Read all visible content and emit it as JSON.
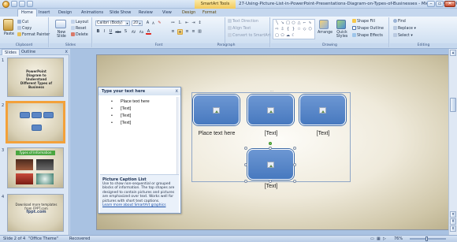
{
  "window": {
    "title": "27-Using-Picture-List-in-PowerPoint-Presentations-Diagram-on-Types-of-Businesses - Microsoft PowerPoint",
    "contextual_header": "SmartArt Tools",
    "minimize": "–",
    "maximize": "▫",
    "close": "✕"
  },
  "tabs": [
    "Home",
    "Insert",
    "Design",
    "Animations",
    "Slide Show",
    "Review",
    "View",
    "Design",
    "Format"
  ],
  "ribbon": {
    "clipboard": {
      "label": "Clipboard",
      "paste": "Paste",
      "cut": "Cut",
      "copy": "Copy",
      "format_painter": "Format Painter"
    },
    "slides": {
      "label": "Slides",
      "new_slide": "New Slide",
      "layout": "Layout",
      "reset": "Reset",
      "delete": "Delete"
    },
    "font": {
      "label": "Font",
      "font_name": "Calibri (Body)",
      "font_size": "20",
      "bold": "B",
      "italic": "I",
      "underline": "U",
      "strike": "abc",
      "shadow": "S",
      "spacing": "AV",
      "case": "Aa",
      "color": "A"
    },
    "paragraph": {
      "label": "Paragraph",
      "text_direction": "Text Direction",
      "align_text": "Align Text",
      "convert_smartart": "Convert to SmartArt"
    },
    "drawing": {
      "label": "Drawing",
      "arrange": "Arrange",
      "quick_styles": "Quick Styles",
      "shape_fill": "Shape Fill",
      "shape_outline": "Shape Outline",
      "shape_effects": "Shape Effects"
    },
    "editing": {
      "label": "Editing",
      "find": "Find",
      "replace": "Replace",
      "select": "Select"
    }
  },
  "slides_pane": {
    "tab_slides": "Slides",
    "tab_outline": "Outline",
    "close": "x",
    "thumbnails": [
      {
        "number": "1",
        "title": "PowerPoint Diagram to Understand Different Types of Business"
      },
      {
        "number": "2"
      },
      {
        "number": "3",
        "banner": "Types of Information"
      },
      {
        "number": "4",
        "title": "Download more templates from FPPT.com",
        "subtitle": "fppt.com"
      }
    ]
  },
  "smartart": {
    "captions": [
      "Place text here",
      "[Text]",
      "[Text]",
      "[Text]"
    ]
  },
  "text_pane": {
    "header": "Type your text here",
    "close": "x",
    "items": [
      "Place text here",
      "[Text]",
      "[Text]",
      "[Text]"
    ],
    "description_title": "Picture Caption List",
    "description_body": "Use to show non-sequential or grouped blocks of information. The top shapes are designed to contain pictures and pictures are emphasized over text. Works well for pictures with short text captions.",
    "learn_more": "Learn more about SmartArt graphics"
  },
  "statusbar": {
    "slide_info": "Slide 2 of 4",
    "theme": "\"Office Theme\"",
    "recovered": "Recovered",
    "zoom": "76%"
  }
}
